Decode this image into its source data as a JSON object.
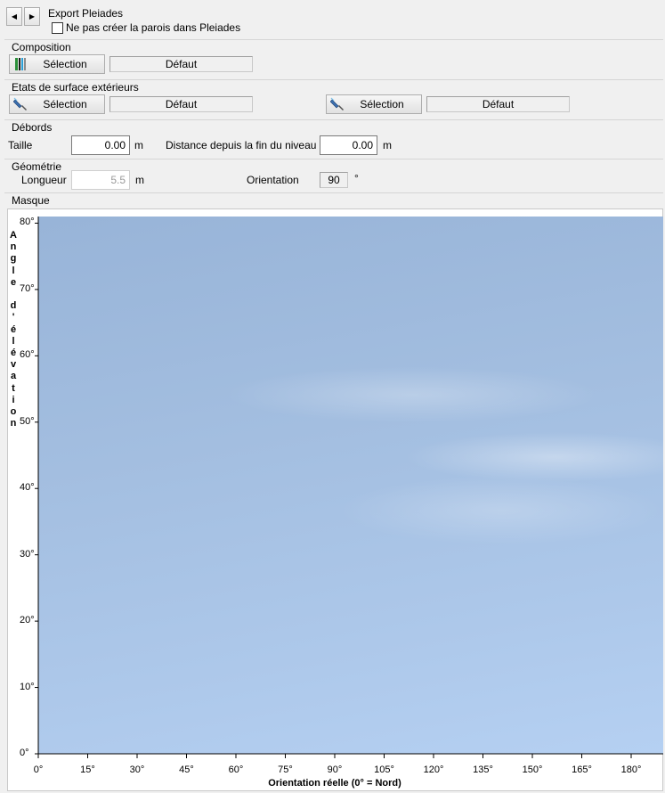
{
  "export": {
    "group_label": "Export Pleiades",
    "checkbox_label": "Ne pas créer la parois dans Pleiades",
    "checked": false
  },
  "composition": {
    "group_label": "Composition",
    "select_label": "Sélection",
    "value": "Défaut"
  },
  "surface": {
    "group_label": "Etats de surface extérieurs",
    "select_label_1": "Sélection",
    "value_1": "Défaut",
    "select_label_2": "Sélection",
    "value_2": "Défaut"
  },
  "debords": {
    "group_label": "Débords",
    "taille_label": "Taille",
    "taille_value": "0.00",
    "taille_unit": "m",
    "distance_label": "Distance depuis la fin du niveau",
    "distance_value": "0.00",
    "distance_unit": "m"
  },
  "geometrie": {
    "group_label": "Géométrie",
    "longueur_label": "Longueur",
    "longueur_value": "5.5",
    "longueur_unit": "m",
    "orientation_label": "Orientation",
    "orientation_value": "90",
    "orientation_unit": "°"
  },
  "masque": {
    "group_label": "Masque"
  },
  "chart_data": {
    "type": "area",
    "title": "",
    "xlabel": "Orientation réelle (0° = Nord)",
    "ylabel": "Angle d'élévation",
    "x_ticks": [
      "0°",
      "15°",
      "30°",
      "45°",
      "60°",
      "75°",
      "90°",
      "105°",
      "120°",
      "135°",
      "150°",
      "165°",
      "180°"
    ],
    "y_ticks": [
      "0°",
      "10°",
      "20°",
      "30°",
      "40°",
      "50°",
      "60°",
      "70°",
      "80°"
    ],
    "xlim": [
      0,
      180
    ],
    "ylim": [
      0,
      90
    ],
    "series": [],
    "background": "sky-image"
  },
  "colors": {
    "window_bg": "#f0f0f0",
    "sky_top": "#98b4d8",
    "sky_bottom": "#b5d0f2"
  }
}
